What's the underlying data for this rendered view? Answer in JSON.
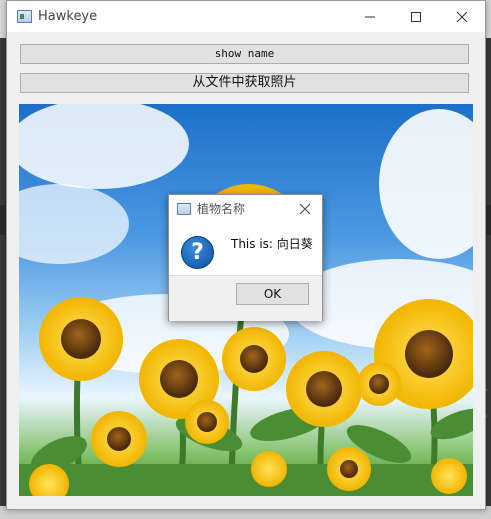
{
  "window": {
    "title": "Hawkeye",
    "controls": {
      "minimize": "minimize-icon",
      "maximize": "maximize-icon",
      "close": "close-icon"
    }
  },
  "buttons": {
    "show_name": "show name",
    "load_from_file": "从文件中获取照片"
  },
  "image": {
    "subject": "sunflower field under blue sky"
  },
  "dialog": {
    "title": "植物名称",
    "icon": "question-icon",
    "message": "This is: 向日葵",
    "ok_label": "OK"
  },
  "colors": {
    "titlebar": "#ffffff",
    "window_bg": "#f0f0f0",
    "button_bg": "#e1e1e1",
    "question_icon": "#0b5fb8"
  }
}
